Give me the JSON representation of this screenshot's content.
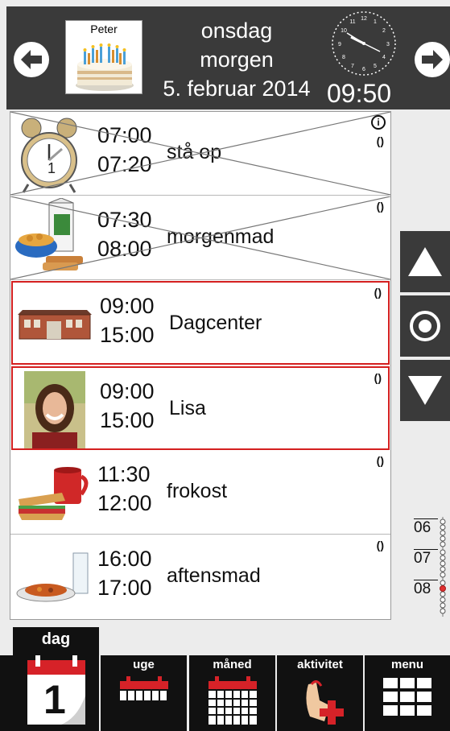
{
  "header": {
    "profile_name": "Peter",
    "weekday": "onsdag",
    "daypart": "morgen",
    "date": "5. februar 2014",
    "time": "09:50"
  },
  "schedule": [
    {
      "start": "07:00",
      "end": "07:20",
      "label": "stå op",
      "picture": "alarm-clock-icon",
      "done": true,
      "info": true,
      "active": false
    },
    {
      "start": "07:30",
      "end": "08:00",
      "label": "morgenmad",
      "picture": "breakfast-icon",
      "done": true,
      "info": false,
      "active": false
    },
    {
      "start": "09:00",
      "end": "15:00",
      "label": "Dagcenter",
      "picture": "building-icon",
      "done": false,
      "info": false,
      "active": true
    },
    {
      "start": "09:00",
      "end": "15:00",
      "label": "Lisa",
      "picture": "person-photo",
      "done": false,
      "info": false,
      "active": true
    },
    {
      "start": "11:30",
      "end": "12:00",
      "label": "frokost",
      "picture": "sandwich-mug-icon",
      "done": false,
      "info": false,
      "active": false
    },
    {
      "start": "16:00",
      "end": "17:00",
      "label": "aftensmad",
      "picture": "soup-bowl-icon",
      "done": false,
      "info": false,
      "active": false
    }
  ],
  "timeline": {
    "hours": [
      "06",
      "07",
      "08"
    ]
  },
  "tabs": {
    "dag": "dag",
    "uge": "uge",
    "maaned": "måned",
    "aktivitet": "aktivitet",
    "menu": "menu"
  },
  "colors": {
    "active_border": "#d42020",
    "header_bg": "#3a3a3a",
    "tab_bg": "#111111",
    "calendar_red": "#d62228"
  }
}
